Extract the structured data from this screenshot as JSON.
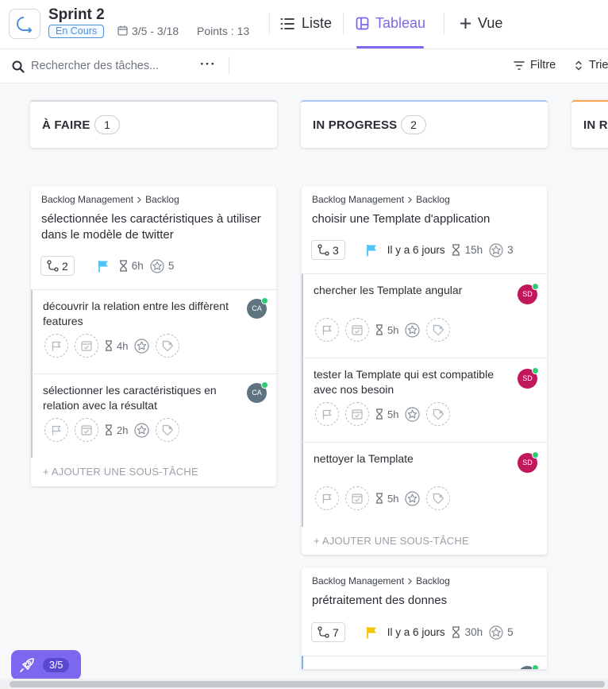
{
  "header": {
    "sprint_title": "Sprint 2",
    "status": "En Cours",
    "dates": "3/5 - 3/18",
    "points": "Points : 13",
    "tabs": [
      {
        "label": "Liste",
        "icon": "list-icon",
        "active": false
      },
      {
        "label": "Tableau",
        "icon": "board-icon",
        "active": true
      },
      {
        "label": "Vue",
        "icon": "plus-icon",
        "active": false
      }
    ],
    "accent_color": "#7b68ee"
  },
  "toolbar": {
    "search_placeholder": "Rechercher des tâches...",
    "more": "···",
    "filter_label": "Filtre",
    "sort_label": "Trie"
  },
  "columns": [
    {
      "title": "À FAIRE",
      "count": "1",
      "color": "#d5d9de"
    },
    {
      "title": "IN PROGRESS",
      "count": "2",
      "color": "#a5c8f5"
    },
    {
      "title": "IN R",
      "color": "#f6a650"
    }
  ],
  "cards": [
    {
      "crumb_a": "Backlog Management",
      "crumb_b": "Backlog",
      "title": "sélectionnée les caractéristiques à utiliser dans le modèle de twitter",
      "subtask_count": "2",
      "flag_color": "#4ec3f7",
      "time": "6h",
      "points": "5",
      "subtasks": [
        {
          "title": "découvrir la relation entre les diffèrent features",
          "avatar": "CA",
          "time": "4h"
        },
        {
          "title": "sélectionner les caractéristiques en relation avec la résultat",
          "avatar": "CA",
          "time": "2h"
        }
      ],
      "add_subtask": "+ AJOUTER UNE SOUS-TÂCHE"
    },
    {
      "crumb_a": "Backlog Management",
      "crumb_b": "Backlog",
      "title": "choisir une Template d'application",
      "subtask_count": "3",
      "flag_color": "#4ec3f7",
      "due": "Il y a 6 jours",
      "time": "15h",
      "points": "3",
      "subtasks": [
        {
          "title": "chercher les Template angular",
          "avatar": "SD",
          "time": "5h"
        },
        {
          "title": "tester la Template qui est compatible avec nos besoin",
          "avatar": "SD",
          "time": "5h"
        },
        {
          "title": "nettoyer la Template",
          "avatar": "SD",
          "time": "5h"
        }
      ],
      "add_subtask": "+ AJOUTER UNE SOUS-TÂCHE"
    },
    {
      "crumb_a": "Backlog Management",
      "crumb_b": "Backlog",
      "title": "prétraitement des donnes",
      "subtask_count": "7",
      "flag_color": "#f5c400",
      "due": "Il y a 6 jours",
      "time": "30h",
      "points": "5"
    }
  ],
  "avatar_colors": {
    "CA": "#5f7380",
    "SD": "#c2185b"
  },
  "rocket": {
    "label": "3/5"
  }
}
